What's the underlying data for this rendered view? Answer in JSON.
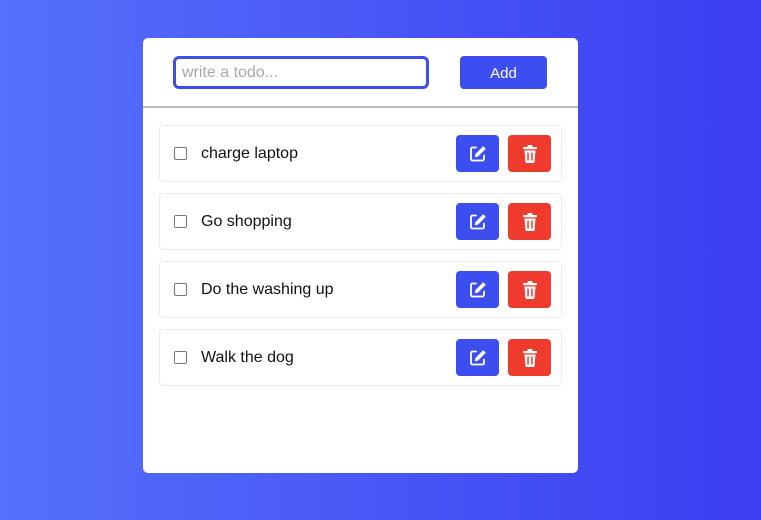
{
  "form": {
    "input_placeholder": "write a todo...",
    "input_value": "",
    "add_label": "Add"
  },
  "todos": [
    {
      "text": "charge laptop",
      "checked": false
    },
    {
      "text": "Go shopping",
      "checked": false
    },
    {
      "text": "Do the washing up",
      "checked": false
    },
    {
      "text": "Walk the dog",
      "checked": false
    }
  ],
  "icons": {
    "edit": "edit-icon",
    "delete": "trash-icon"
  },
  "colors": {
    "accent": "#3c4ef0",
    "danger": "#ef3b2d",
    "background_start": "#5570fb",
    "background_end": "#3b3ef1"
  }
}
